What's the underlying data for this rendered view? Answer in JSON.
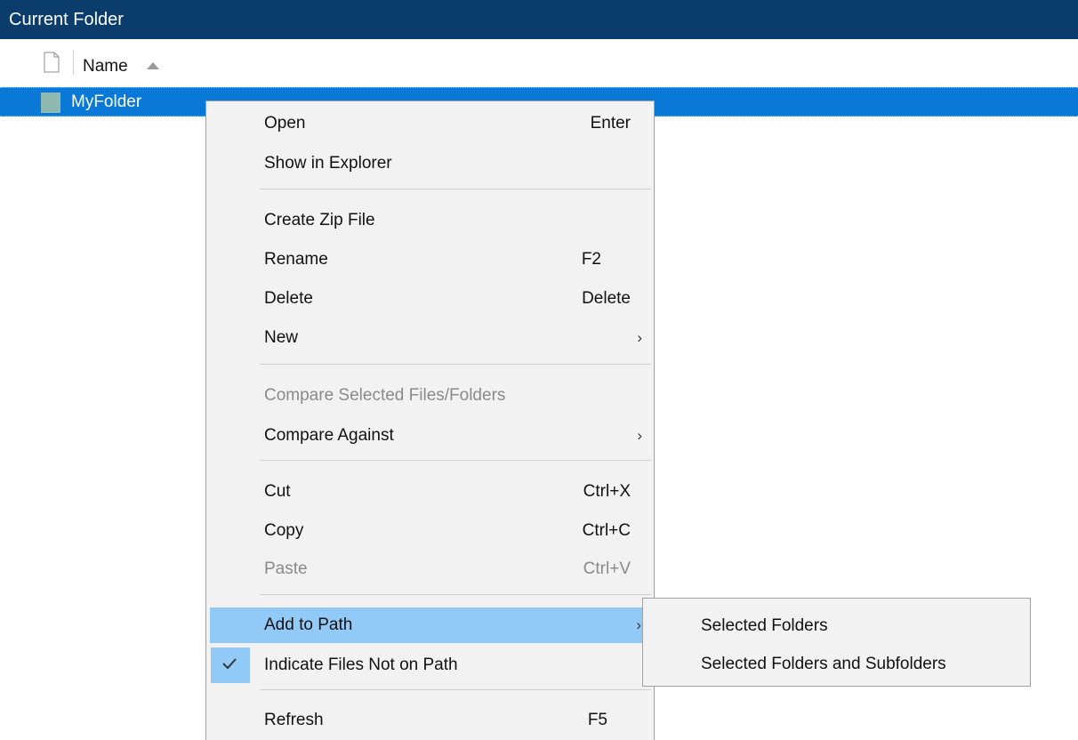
{
  "panel": {
    "title": "Current Folder"
  },
  "columns": {
    "name_label": "Name",
    "file_icon": "file-icon",
    "sort_icon": "sort-ascending-icon"
  },
  "file_list": {
    "selected_item": "MyFolder",
    "selected_icon": "folder-icon"
  },
  "context_menu": {
    "open": {
      "label": "Open",
      "shortcut": "Enter"
    },
    "show_in_explorer": {
      "label": "Show in Explorer"
    },
    "create_zip": {
      "label": "Create Zip File"
    },
    "rename": {
      "label": "Rename",
      "shortcut": "F2"
    },
    "delete": {
      "label": "Delete",
      "shortcut": "Delete"
    },
    "new": {
      "label": "New",
      "arrow": "›"
    },
    "compare_selected": {
      "label": "Compare Selected Files/Folders",
      "disabled": true
    },
    "compare_against": {
      "label": "Compare Against",
      "arrow": "›"
    },
    "cut": {
      "label": "Cut",
      "shortcut": "Ctrl+X"
    },
    "copy": {
      "label": "Copy",
      "shortcut": "Ctrl+C"
    },
    "paste": {
      "label": "Paste",
      "shortcut": "Ctrl+V",
      "disabled": true
    },
    "add_to_path": {
      "label": "Add to Path",
      "arrow": "›",
      "highlighted": true
    },
    "indicate_files": {
      "label": "Indicate Files Not on Path",
      "checked": true,
      "check_icon": "checkmark-icon"
    },
    "refresh": {
      "label": "Refresh",
      "shortcut": "F5"
    }
  },
  "submenu": {
    "selected_folders": {
      "label": "Selected Folders"
    },
    "selected_folders_subfolders": {
      "label": "Selected Folders and Subfolders"
    }
  },
  "colors": {
    "title_bar": "#0a3d6b",
    "selection": "#0a78d7",
    "menu_highlight": "#91c9f7",
    "menu_background": "#f2f2f2",
    "disabled_text": "#8a8a8a"
  }
}
